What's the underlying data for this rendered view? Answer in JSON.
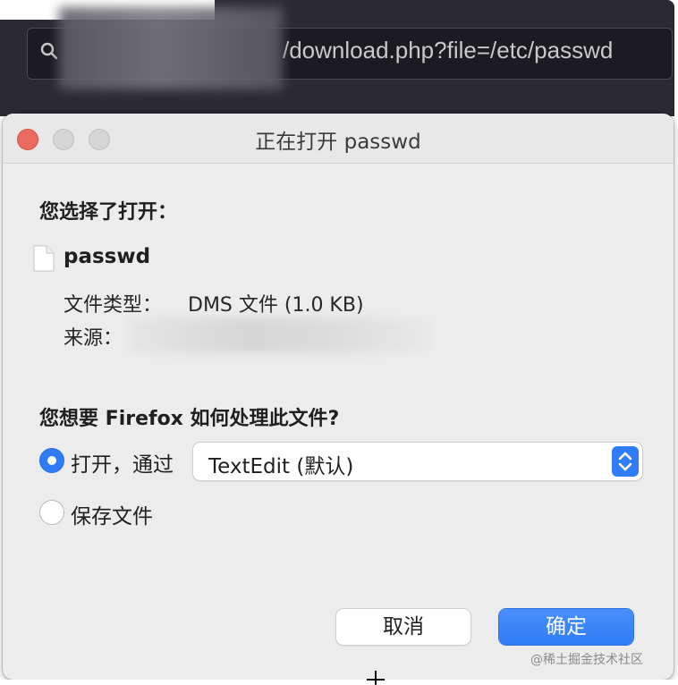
{
  "browser": {
    "url_visible_text": "/download.php?file=/etc/passwd"
  },
  "dialog": {
    "title": "正在打开 passwd",
    "you_chose_label": "您选择了打开：",
    "file": {
      "name": "passwd",
      "type_label": "文件类型：",
      "type_value": "DMS 文件 (1.0 KB)",
      "source_label": "来源："
    },
    "question": "您想要 Firefox 如何处理此文件?",
    "options": {
      "open_with_label": "打开，通过",
      "open_with_app": "TextEdit (默认)",
      "open_with_selected": true,
      "save_label": "保存文件",
      "save_selected": false
    },
    "buttons": {
      "cancel": "取消",
      "ok": "确定"
    }
  },
  "watermark": "@稀土掘金技术社区",
  "colors": {
    "accent": "#2f7cf6",
    "close_button": "#ed6a5e",
    "dialog_bg": "#ececec"
  },
  "icons": [
    "search-icon",
    "document-icon",
    "chevron-updown-icon",
    "crosshair-cursor-icon"
  ]
}
